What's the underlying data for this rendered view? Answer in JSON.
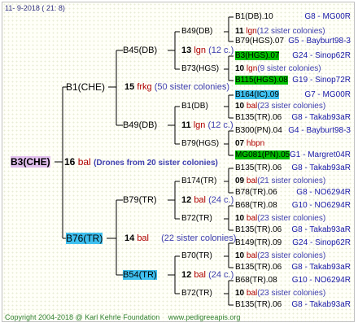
{
  "header": {
    "date": "11-  9-2018 (  21:   8)"
  },
  "footer": {
    "copyright": "Copyright 2004-2018 @ Karl Kehrle Foundation",
    "url": "www.pedigreeapis.org"
  },
  "root": {
    "name": "B3(CHE)",
    "num": "16",
    "line": "bal",
    "note": "(Drones from 20 sister colonies)"
  },
  "gen1": [
    {
      "name": "B1(CHE)",
      "num": "15",
      "line": "frkg",
      "note": "(50 sister colonies)"
    },
    {
      "name": "B76(TR)",
      "num": "14",
      "line": "bal",
      "note": "(22 sister colonies)"
    }
  ],
  "gen2": [
    {
      "name": "B45(DB)",
      "num": "13",
      "line": "lgn",
      "note": "(12 c.)"
    },
    {
      "name": "B49(DB)",
      "num": "11",
      "line": "lgn",
      "note": "(12 c.)"
    },
    {
      "name": "B79(TR)",
      "num": "12",
      "line": "bal",
      "note": "(24 c.)"
    },
    {
      "name": "B54(TR)",
      "num": "12",
      "line": "bal",
      "note": "(24 c.)"
    }
  ],
  "gen3": [
    {
      "name": "B49(DB)",
      "num": "11",
      "line": "lgn",
      "note": "(12 sister colonies)"
    },
    {
      "name": "B73(HGS)",
      "num": "10",
      "line": "lgn",
      "note": "(9 sister colonies)"
    },
    {
      "name": "B1(DB)",
      "num": "10",
      "line": "bal",
      "note": "(23 sister colonies)"
    },
    {
      "name": "B79(HGS)",
      "num": "07",
      "line": "hbpn",
      "note": ""
    },
    {
      "name": "B174(TR)",
      "num": "09",
      "line": "bal",
      "note": "(21 sister colonies)"
    },
    {
      "name": "B72(TR)",
      "num": "10",
      "line": "bal",
      "note": "(23 sister colonies)"
    },
    {
      "name": "B70(TR)",
      "num": "10",
      "line": "bal",
      "note": "(23 sister colonies)"
    },
    {
      "name": "B72(TR)",
      "num": "10",
      "line": "bal",
      "note": "(23 sister colonies)"
    }
  ],
  "gen4": [
    {
      "name": "B1(DB).10",
      "right": "G8 - MG00R"
    },
    {
      "name": "B79(HGS).07",
      "right": "G5 - Bayburt98-3"
    },
    {
      "name": "B3(HGS).07",
      "right": "G24 - Sinop62R"
    },
    {
      "name": "B115(HGS).08",
      "right": "G19 - Sinop72R"
    },
    {
      "name": "B164(IC).09",
      "right": "G7 - MG00R"
    },
    {
      "name": "B135(TR).06",
      "right": "G8 - Takab93aR"
    },
    {
      "name": "B300(PN).04",
      "right": "G4 - Bayburt98-3"
    },
    {
      "name": "MG081(PN).05",
      "right": "G1 - Margret04R"
    },
    {
      "name": "B135(TR).06",
      "right": "G8 - Takab93aR"
    },
    {
      "name": "B78(TR).06",
      "right": "G8 - NO6294R"
    },
    {
      "name": "B68(TR).08",
      "right": "G10 - NO6294R"
    },
    {
      "name": "B135(TR).06",
      "right": "G8 - Takab93aR"
    },
    {
      "name": "B149(TR).09",
      "right": "G24 - Sinop62R"
    },
    {
      "name": "B135(TR).06",
      "right": "G8 - Takab93aR"
    },
    {
      "name": "B68(TR).08",
      "right": "G10 - NO6294R"
    },
    {
      "name": "B135(TR).06",
      "right": "G8 - Takab93aR"
    }
  ]
}
